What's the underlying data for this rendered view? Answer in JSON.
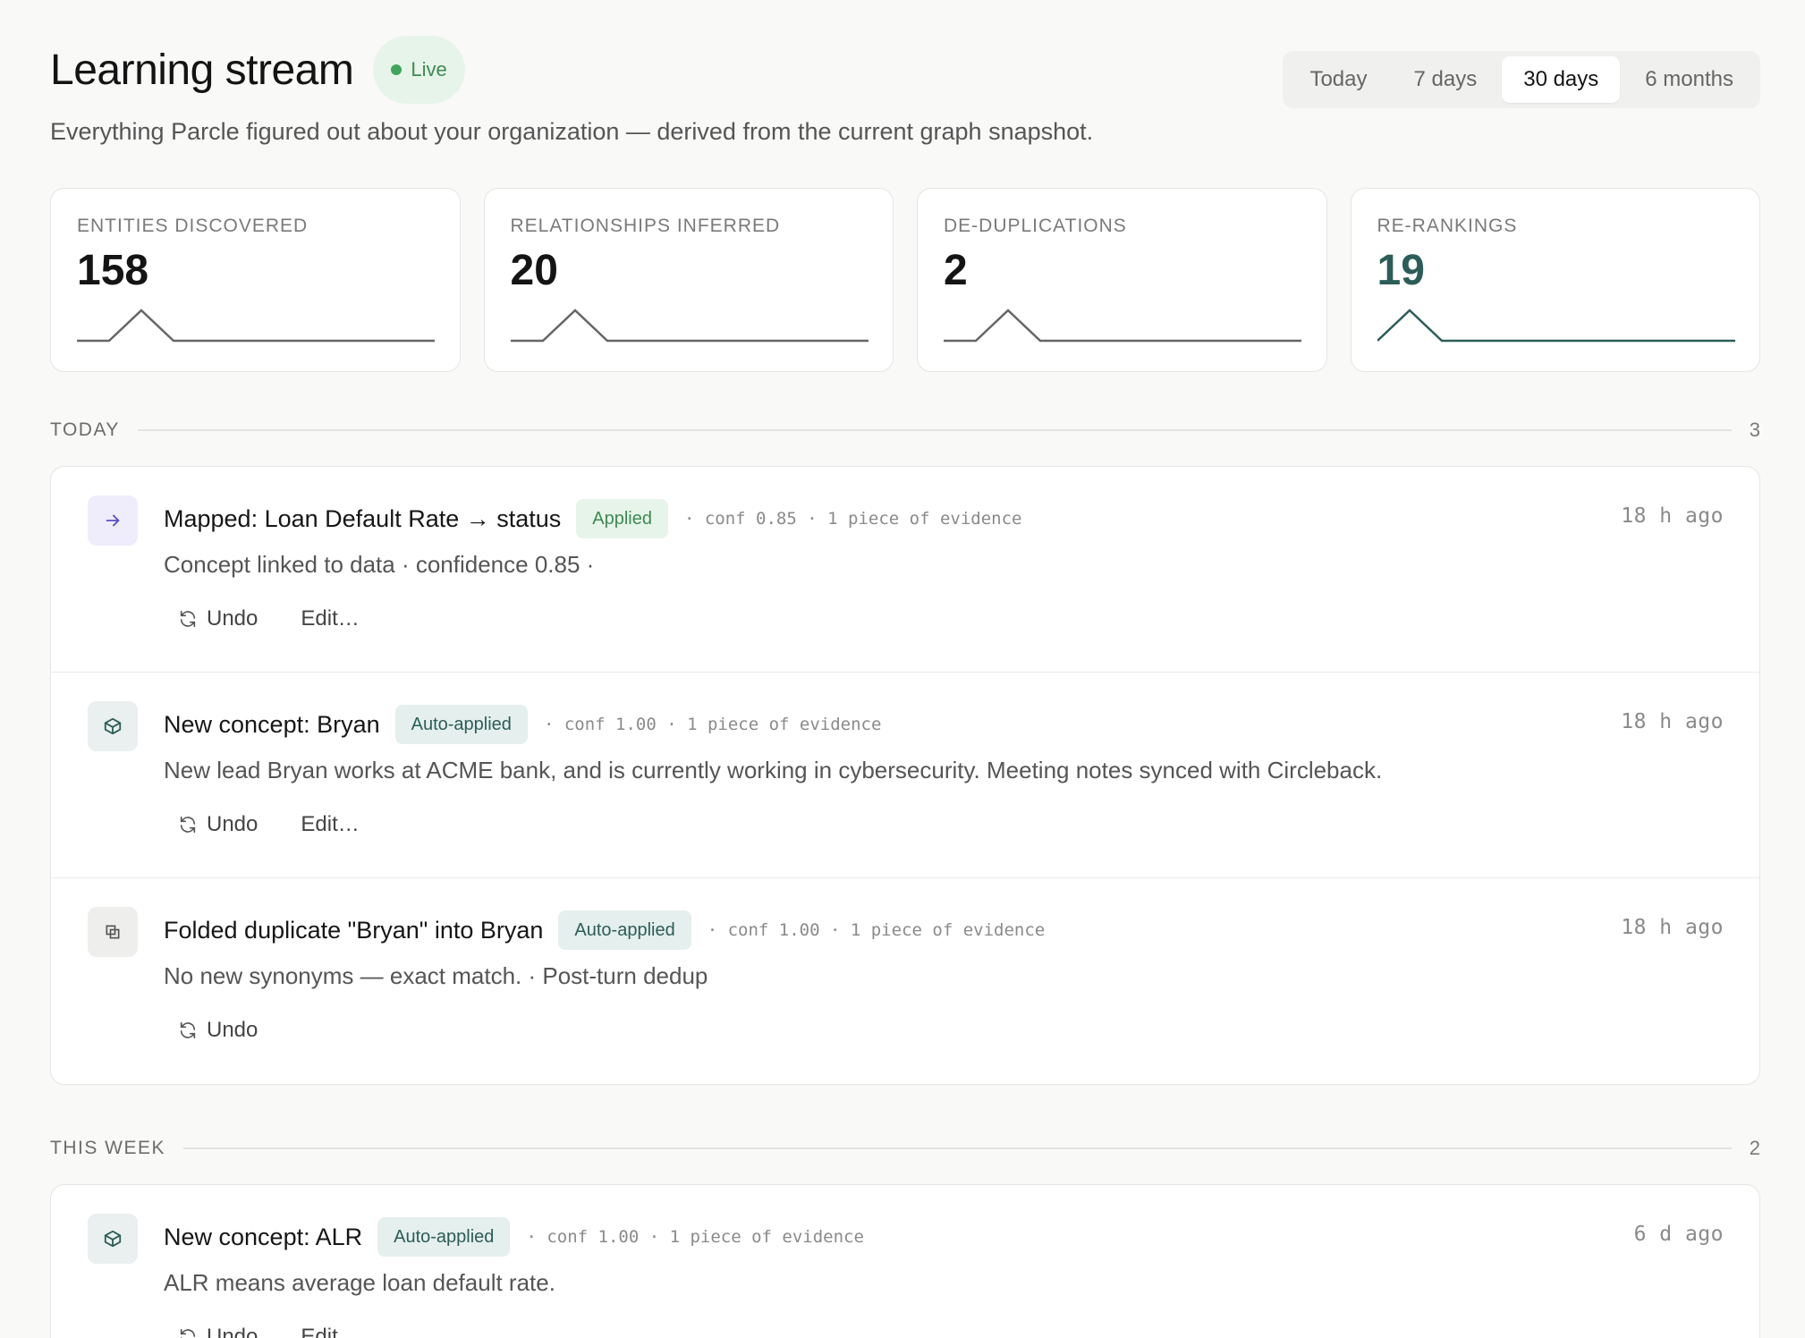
{
  "header": {
    "title": "Learning stream",
    "live_label": "Live",
    "subtitle": "Everything Parcle figured out about your organization — derived from the current graph snapshot.",
    "ranges": [
      "Today",
      "7 days",
      "30 days",
      "6 months"
    ],
    "active_range": "30 days"
  },
  "stats": [
    {
      "label": "ENTITIES DISCOVERED",
      "value": "158"
    },
    {
      "label": "RELATIONSHIPS INFERRED",
      "value": "20"
    },
    {
      "label": "DE-DUPLICATIONS",
      "value": "2"
    },
    {
      "label": "RE-RANKINGS",
      "value": "19"
    }
  ],
  "sections": [
    {
      "title": "TODAY",
      "count": "3",
      "items": [
        {
          "icon": "arrow-right-icon",
          "title": "Mapped: Loan Default Rate → status",
          "badge": "Applied",
          "meta": "· conf 0.85 · 1 piece of evidence",
          "time": "18 h ago",
          "desc": "Concept linked to data · confidence 0.85 ·",
          "actions": [
            "Undo",
            "Edit…"
          ]
        },
        {
          "icon": "cube-icon",
          "title": "New concept: Bryan",
          "badge": "Auto-applied",
          "meta": "· conf 1.00 · 1 piece of evidence",
          "time": "18 h ago",
          "desc": "New lead Bryan works at ACME bank, and is currently working in cybersecurity. Meeting notes synced with Circleback.",
          "actions": [
            "Undo",
            "Edit…"
          ]
        },
        {
          "icon": "merge-icon",
          "title": "Folded duplicate \"Bryan\" into Bryan",
          "badge": "Auto-applied",
          "meta": "· conf 1.00 · 1 piece of evidence",
          "time": "18 h ago",
          "desc": "No new synonyms — exact match. · Post-turn dedup",
          "actions": [
            "Undo"
          ]
        }
      ]
    },
    {
      "title": "THIS WEEK",
      "count": "2",
      "items": [
        {
          "icon": "cube-icon",
          "title": "New concept: ALR",
          "badge": "Auto-applied",
          "meta": "· conf 1.00 · 1 piece of evidence",
          "time": "6 d ago",
          "desc": "ALR means average loan default rate.",
          "actions": [
            "Undo",
            "Edit…"
          ]
        }
      ]
    }
  ],
  "colors": {
    "accent": "#2c5d58",
    "applied_green": "#3d8a53",
    "purple": "#5a4fc4"
  }
}
